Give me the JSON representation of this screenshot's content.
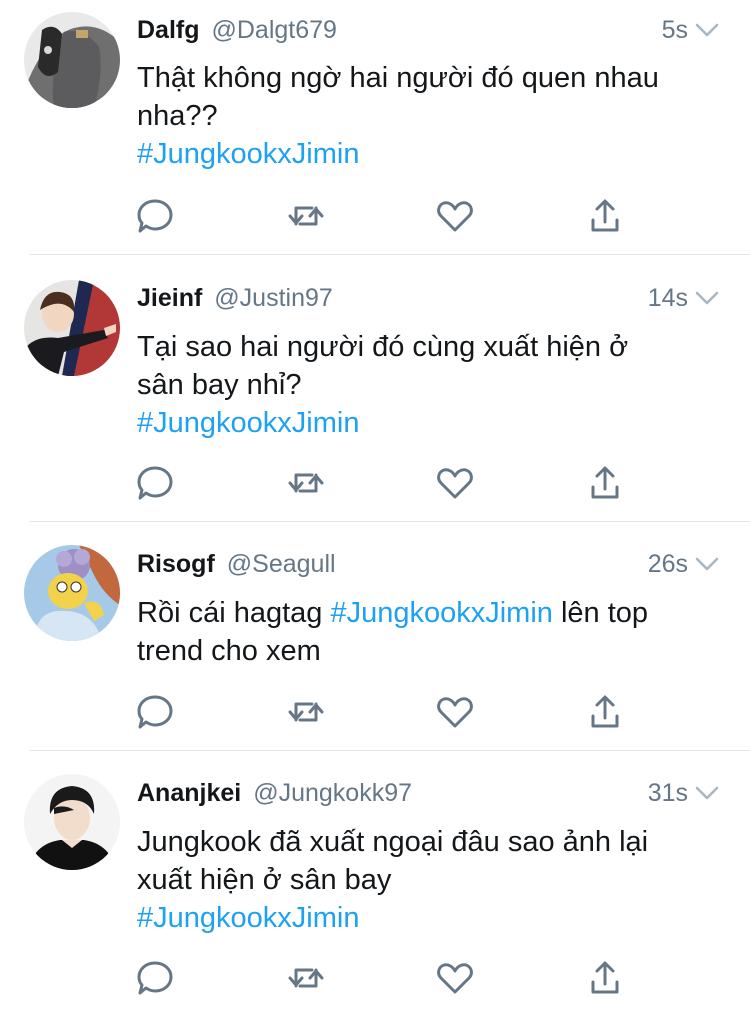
{
  "accent_color": "#1da1f2",
  "secondary_text_color": "#657786",
  "tweets": [
    {
      "name": "Dalfg",
      "handle": "@Dalgt679",
      "time": "5s",
      "text_lines": [
        "Thật không ngờ hai người đó quen nhau",
        "nha??"
      ],
      "hashtag_line": "#JungkookxJimin",
      "avatar_icon": "gray-hoodie-avatar"
    },
    {
      "name": "Jieinf",
      "handle": "@Justin97",
      "time": "14s",
      "text_lines": [
        "Tại sao hai người đó cùng xuất hiện ở",
        "sân bay nhỉ?"
      ],
      "hashtag_line": "#JungkookxJimin",
      "avatar_icon": "person-pointing-avatar"
    },
    {
      "name": "Risogf",
      "handle": "@Seagull",
      "time": "26s",
      "text_before_hashtag": "Rồi cái hagtag ",
      "inline_hashtag": "#JungkookxJimin",
      "text_after_hashtag": " lên top",
      "text_line2": "trend cho xem",
      "avatar_icon": "cartoon-character-avatar"
    },
    {
      "name": "Ananjkei",
      "handle": "@Jungkokk97",
      "time": "31s",
      "text_lines": [
        "Jungkook đã xuất ngoại đâu sao ảnh lại",
        "xuất hiện ở sân bay"
      ],
      "hashtag_line": "#JungkookxJimin",
      "avatar_icon": "young-man-avatar"
    }
  ],
  "action_icons": [
    "reply-icon",
    "retweet-icon",
    "like-icon",
    "share-icon"
  ]
}
